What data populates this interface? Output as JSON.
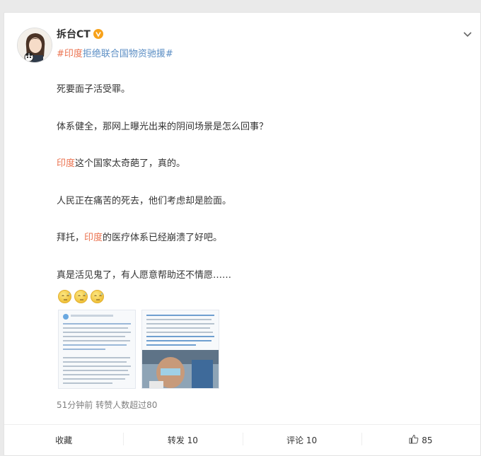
{
  "post": {
    "username": "拆台CT",
    "topic_prefix": "#印度",
    "topic_rest": "拒绝联合国物资驰援#",
    "lines": [
      [
        {
          "t": "死要面子活受罪。",
          "h": false
        }
      ],
      [
        {
          "t": "体系健全，那网上曝光出来的阴间场景是怎么回事？",
          "h": false
        }
      ],
      [
        {
          "t": "印度",
          "h": true
        },
        {
          "t": "这个国家太奇葩了，真的。",
          "h": false
        }
      ],
      [
        {
          "t": "人民正在痛苦的死去，他们考虑却是脸面。",
          "h": false
        }
      ],
      [
        {
          "t": "拜托，",
          "h": false
        },
        {
          "t": "印度",
          "h": true
        },
        {
          "t": "的医疗体系已经崩溃了好吧。",
          "h": false
        }
      ],
      [
        {
          "t": "真是活见鬼了，有人愿意帮助还不情愿……",
          "h": false
        }
      ]
    ],
    "emoji_icons": [
      "sweat-face-icon",
      "sweat-face-icon",
      "sweat-face-icon"
    ],
    "meta": "51分钟前  转赞人数超过80"
  },
  "footer": {
    "favorite": "收藏",
    "repost": "转发 10",
    "comment": "评论 10",
    "like_count": "85"
  },
  "colors": {
    "highlight": "#eb7350",
    "topic": "#5b8ec4",
    "verified": "#f7a21b"
  }
}
